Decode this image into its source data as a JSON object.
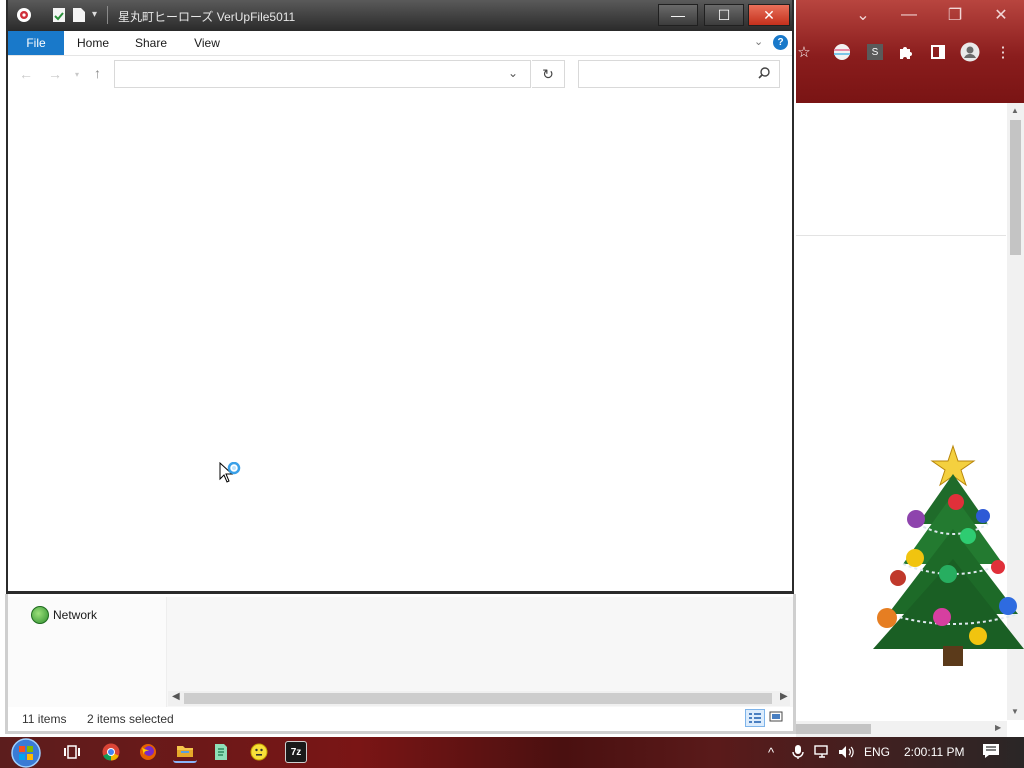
{
  "explorer": {
    "title": "星丸町ヒーローズ  VerUpFile5011",
    "window_controls": {
      "minimize": "—",
      "maximize": "☐",
      "close": "✕"
    },
    "ribbon_tabs": [
      "File",
      "Home",
      "Share",
      "View"
    ],
    "help_label": "?",
    "address_value": "",
    "search_value": "",
    "nav_pane": {
      "network_label": "Network"
    },
    "status": {
      "items": "11 items",
      "selected": "2 items selected"
    },
    "accent_color": "#1979ca"
  },
  "taskbar": {
    "apps": [
      "task-view",
      "chrome",
      "firefox",
      "file-explorer",
      "notepad",
      "smiley",
      "7-zip"
    ],
    "app_7zip_label": "7z",
    "language": "ENG",
    "clock": "2:00:11 PM"
  },
  "browser": {
    "profile_badge": "S"
  }
}
